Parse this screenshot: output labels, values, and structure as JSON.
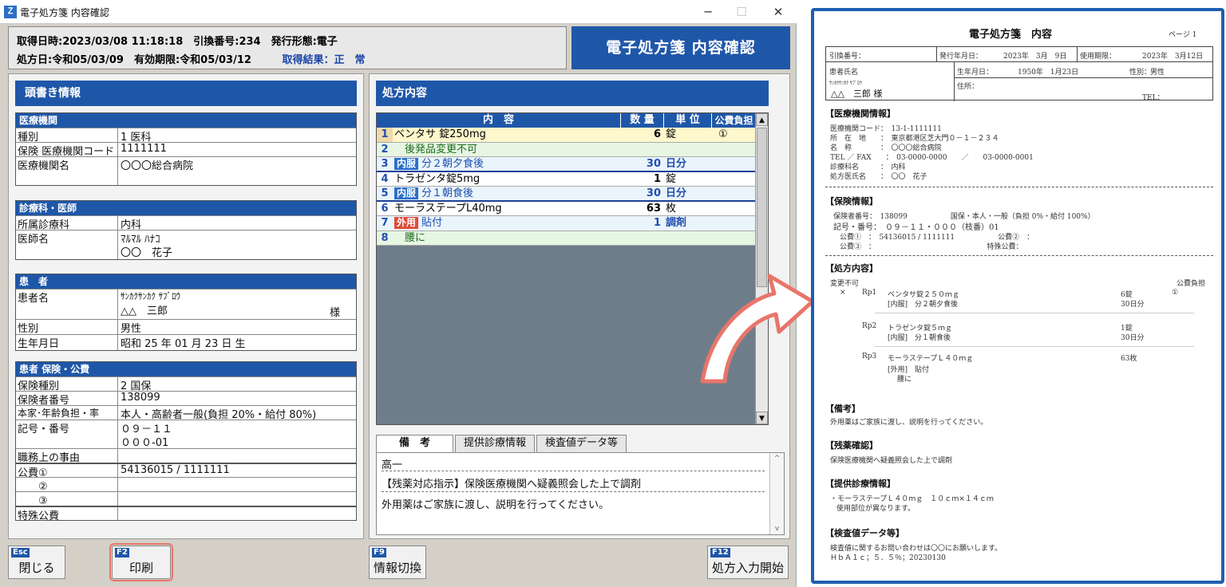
{
  "window": {
    "title": "電子処方箋 内容確認",
    "app_icon": "Ｚ",
    "minimize": "─",
    "maximize": "☐",
    "close": "✕"
  },
  "info": {
    "line1": "取得日時:2023/03/08 11:18:18　引換番号:234　発行形態:電子",
    "line2": "処方日:令和05/03/09　有効期限:令和05/03/12",
    "result": "取得結果：正　常",
    "big_title": "電子処方箋 内容確認"
  },
  "left": {
    "header": "頭書き情報",
    "institution": {
      "title": "医療機関",
      "rows": [
        {
          "k": "種別",
          "v": "1 医科"
        },
        {
          "k": "保険 医療機関コード",
          "v": "1111111"
        },
        {
          "k": "医療機関名",
          "v": "〇〇〇総合病院"
        }
      ]
    },
    "department": {
      "title": "診療科・医師",
      "rows": [
        {
          "k": "所属診療科",
          "v": "内科"
        },
        {
          "k": "医師名",
          "v": "ﾏﾙﾏﾙ ﾊﾅｺ"
        },
        {
          "k": "",
          "v": "〇〇　花子"
        }
      ]
    },
    "patient": {
      "title": "患　者",
      "name_label": "患者名",
      "name_kana": "ｻﾝｶｸｻﾝｶｸ ｻﾌﾞﾛｳ",
      "name": "△△　三郎",
      "sama": "様",
      "rows": [
        {
          "k": "性別",
          "v": " 男性"
        },
        {
          "k": "生年月日",
          "v": " 昭和 25 年 01 月 23 日 生"
        }
      ]
    },
    "insurance": {
      "title": "患者 保険・公費",
      "rows": [
        {
          "k": "保険種別",
          "v": "2 国保"
        },
        {
          "k": "保険者番号",
          "v": "138099"
        },
        {
          "k": "本家･年齢負担・率",
          "v": "本人・高齢者一般(負担 20%・給付 80%)"
        },
        {
          "k": "記号・番号",
          "v": "０９－１１"
        },
        {
          "k": "",
          "v": "０００-01"
        },
        {
          "k": "職務上の事由",
          "v": ""
        },
        {
          "k": "公費①",
          "v": "54136015 / 1111111"
        },
        {
          "k": "　　②",
          "v": ""
        },
        {
          "k": "　　③",
          "v": ""
        },
        {
          "k": "特殊公費",
          "v": ""
        }
      ]
    }
  },
  "prescription": {
    "header": "処方内容",
    "columns": [
      "内　容",
      "数 量",
      "単 位",
      "公費負担"
    ],
    "rows": [
      {
        "n": "1",
        "kind": "drug",
        "tag": "",
        "content": "ベンタサ 錠250mg",
        "qty": "6",
        "unit": "錠",
        "pub": "①"
      },
      {
        "n": "2",
        "kind": "note",
        "tag": "",
        "content": "　後発品変更不可",
        "qty": "",
        "unit": "",
        "pub": ""
      },
      {
        "n": "3",
        "kind": "usage",
        "tag": "内服",
        "content": "分２朝夕食後",
        "qty": "30",
        "unit": "日分",
        "pub": ""
      },
      {
        "n": "4",
        "kind": "drug",
        "tag": "",
        "content": "トラゼンタ錠5mg",
        "qty": "1",
        "unit": "錠",
        "pub": ""
      },
      {
        "n": "5",
        "kind": "usage",
        "tag": "内服",
        "content": "分１朝食後",
        "qty": "30",
        "unit": "日分",
        "pub": ""
      },
      {
        "n": "6",
        "kind": "drug",
        "tag": "",
        "content": "モーラステープL40mg",
        "qty": "63",
        "unit": "枚",
        "pub": ""
      },
      {
        "n": "7",
        "kind": "usage",
        "tag": "外用",
        "content": "貼付",
        "qty": "1",
        "unit": "調剤",
        "pub": ""
      },
      {
        "n": "8",
        "kind": "note",
        "tag": "",
        "content": "　腰に",
        "qty": "",
        "unit": "",
        "pub": ""
      }
    ],
    "scroll_up": "▲",
    "scroll_down": "▼"
  },
  "tabs": [
    "備　考",
    "提供診療情報",
    "検査値データ等"
  ],
  "memo": {
    "line1": "高一",
    "line2": "【残薬対応指示】保険医療機関へ疑義照会した上で調剤",
    "line3": "外用薬はご家族に渡し、説明を行ってください。",
    "up": "^",
    "down": "v"
  },
  "fkeys": [
    {
      "key": "Esc",
      "label": "閉じる"
    },
    {
      "key": "F2",
      "label": "印刷"
    },
    {
      "key": "F9",
      "label": "情報切換"
    },
    {
      "key": "F12",
      "label": "処方入力開始"
    }
  ],
  "doc": {
    "title": "電子処方箋　内容",
    "page": "ページ 1",
    "r1": {
      "exchange_label": "引換番号：",
      "issue_label": "発行年月日：",
      "issue_value": "2023年　3月　9日",
      "expiry_label": "使用期限：",
      "expiry_value": "2023年　3月12日"
    },
    "r2": {
      "patient_label": "患者氏名",
      "birth_label": "生年月日：",
      "birth_value": "1950年　1月23日",
      "sex_label": "性別：",
      "sex_value": "男性"
    },
    "r3": {
      "kana": "ｻﾝｶｸｻﾝｶｸ ｻﾌﾞﾛｳ",
      "address_label": "住所：",
      "name": "△△　三郎 様",
      "tel_label": "TEL："
    },
    "institution_h": "【医療機関情報】",
    "inst_lines": [
      "医療機関コード：　13-1-1111111",
      "所　在　地　　：　東京都港区芝大門０－１－２３４",
      "名　称　　　　：　〇〇〇総合病院",
      "TEL ／ FAX　　：　03-0000-0000　　／　　03-0000-0001",
      "診療科名　　　：　内科",
      "処方医氏名　　：　〇〇　花子"
    ],
    "insurance_h": "【保険情報】",
    "ins_lines": [
      "保険者番号：　138099　　　　　　国保・本人・一般（負担 0%・給付 100%）",
      "記号・番号：　０９－１１・０００（枝番）01",
      "公費①　：　54136015 / 1111111　　　　　　公費②　：",
      "公費③　：　　　　　　　　　　　　　　　　特殊公費："
    ],
    "rx_h": "【処方内容】",
    "rx_nochange": "変更不可",
    "rx_pub": "公費負担",
    "rx_x": "×",
    "rx": [
      {
        "rp": "Rp1",
        "drug": "ベンタサ錠２５０ｍｇ",
        "usage": "[内服]　分２朝夕食後",
        "qty": "6錠",
        "days": "30日分",
        "pub": "①"
      },
      {
        "rp": "Rp2",
        "drug": "トラゼンタ錠５ｍｇ",
        "usage": "[内服]　分１朝食後",
        "qty": "1錠",
        "days": "30日分",
        "pub": ""
      },
      {
        "rp": "Rp3",
        "drug": "モーラステープＬ４０ｍｇ",
        "usage": "[外用]　貼付",
        "qty": "63枚",
        "days": "",
        "pub": "",
        "extra": "腰に"
      }
    ],
    "remarks_h": "【備考】",
    "remarks": "外用薬はご家族に渡し、説明を行ってください。",
    "residual_h": "【残薬確認】",
    "residual": "保険医療機関へ疑義照会した上で調剤",
    "clinical_h": "【提供診療情報】",
    "clinical1": "・モーラステープＬ４０ｍｇ　１０ｃｍ×１４ｃｍ",
    "clinical2": "使用部位が異なります。",
    "lab_h": "【検査値データ等】",
    "lab1": "検査値に関するお問い合わせは〇〇にお願いします。",
    "lab2": "ＨｂＡ１ｃ；５．５％；20230130"
  },
  "colors": {
    "accent": "#1f57a8",
    "highlight": "#e8756a",
    "frame": "#1d5fb0"
  }
}
